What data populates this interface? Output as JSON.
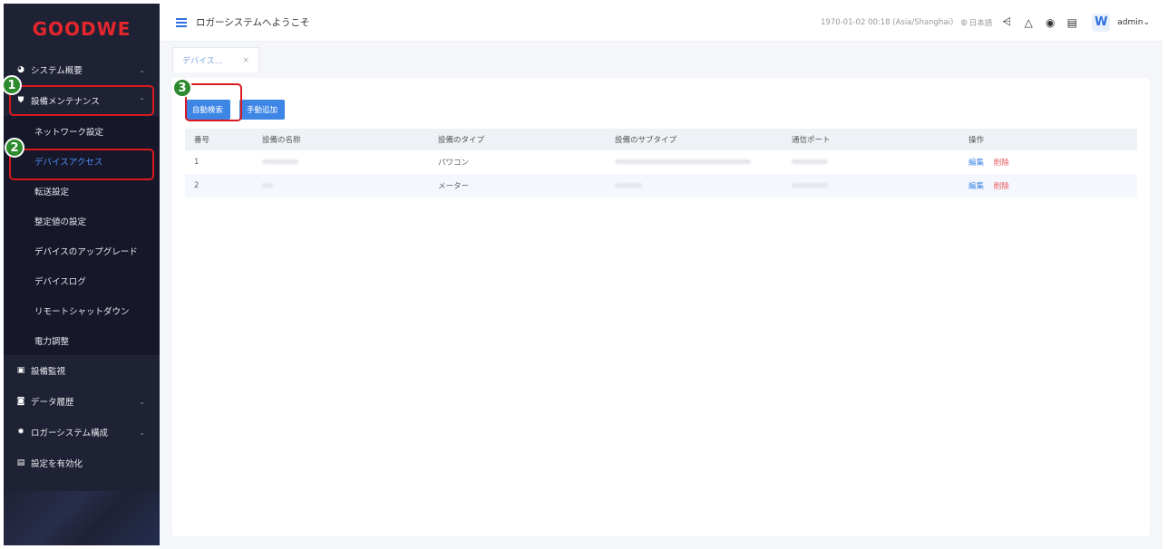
{
  "brand": {
    "logo_text": "GOODWE",
    "color": "#e6262d"
  },
  "sidebar": {
    "items": [
      {
        "label": "システム概要",
        "icon": "dashboard-icon",
        "chevron": "⌄"
      },
      {
        "label": "設備メンテナンス",
        "icon": "shield-icon",
        "chevron": "⌃",
        "children": [
          {
            "label": "ネットワーク設定"
          },
          {
            "label": "デバイスアクセス",
            "active": true
          },
          {
            "label": "転送設定"
          },
          {
            "label": "整定値の設定"
          },
          {
            "label": "デバイスのアップグレード"
          },
          {
            "label": "デバイスログ"
          },
          {
            "label": "リモートシャットダウン"
          },
          {
            "label": "電力調整"
          }
        ]
      },
      {
        "label": "設備監視",
        "icon": "monitor-icon"
      },
      {
        "label": "データ履歴",
        "icon": "history-icon",
        "chevron": "⌄"
      },
      {
        "label": "ロガーシステム構成",
        "icon": "gear-icon",
        "chevron": "⌄"
      },
      {
        "label": "設定を有効化",
        "icon": "apply-icon"
      }
    ]
  },
  "header": {
    "welcome": "ロガーシステムへようこそ",
    "datetime": "1970-01-02 00:18 (Asia/Shanghai)",
    "language": "日本語",
    "avatar_letter": "W",
    "user": "admin"
  },
  "tabs": [
    {
      "label": "デバイス...",
      "close": "×"
    }
  ],
  "toolbar": {
    "auto_search": "自動検索",
    "manual_add": "手動追加"
  },
  "table": {
    "columns": [
      "番号",
      "設備の名称",
      "設備のタイプ",
      "設備のサブタイプ",
      "通信ポート",
      "操作"
    ],
    "rows": [
      {
        "no": "1",
        "type": "パワコン",
        "edit": "編集",
        "delete": "削除"
      },
      {
        "no": "2",
        "type": "メーター",
        "edit": "編集",
        "delete": "削除"
      }
    ]
  },
  "callouts": {
    "one": "1",
    "two": "2",
    "three": "3"
  },
  "colors": {
    "accent": "#3d86e6",
    "highlight": "#d9191f",
    "badge": "#2d8a2e",
    "sidebar_bg": "#1f2235"
  }
}
